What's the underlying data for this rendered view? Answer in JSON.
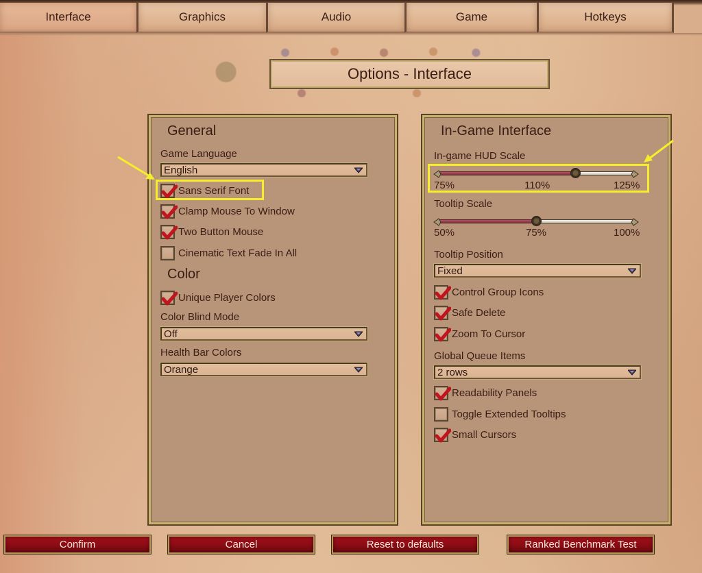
{
  "tabs": [
    {
      "label": "Interface",
      "active": true
    },
    {
      "label": "Graphics",
      "active": false
    },
    {
      "label": "Audio",
      "active": false
    },
    {
      "label": "Game",
      "active": false
    },
    {
      "label": "Hotkeys",
      "active": false
    }
  ],
  "title": "Options - Interface",
  "left_panel": {
    "general": {
      "heading": "General",
      "game_language": {
        "label": "Game Language",
        "value": "English"
      },
      "checkboxes": [
        {
          "label": "Sans Serif Font",
          "checked": true,
          "highlighted": true
        },
        {
          "label": "Clamp Mouse To Window",
          "checked": true
        },
        {
          "label": "Two Button Mouse",
          "checked": true
        },
        {
          "label": "Cinematic Text Fade In All",
          "checked": false
        }
      ]
    },
    "color": {
      "heading": "Color",
      "unique_player_colors": {
        "label": "Unique Player Colors",
        "checked": true
      },
      "color_blind_mode": {
        "label": "Color Blind Mode",
        "value": "Off"
      },
      "health_bar_colors": {
        "label": "Health Bar Colors",
        "value": "Orange"
      }
    }
  },
  "right_panel": {
    "heading": "In-Game Interface",
    "hud_scale": {
      "label": "In-game HUD Scale",
      "min_label": "75%",
      "current_label": "110%",
      "max_label": "125%",
      "min": 75,
      "max": 125,
      "value": 110,
      "highlighted": true
    },
    "tooltip_scale": {
      "label": "Tooltip Scale",
      "min_label": "50%",
      "current_label": "75%",
      "max_label": "100%",
      "min": 50,
      "max": 100,
      "value": 75
    },
    "tooltip_position": {
      "label": "Tooltip Position",
      "value": "Fixed"
    },
    "checkboxes_a": [
      {
        "label": "Control Group Icons",
        "checked": true
      },
      {
        "label": "Safe Delete",
        "checked": true
      },
      {
        "label": "Zoom To Cursor",
        "checked": true
      }
    ],
    "global_queue_items": {
      "label": "Global Queue Items",
      "value": "2 rows"
    },
    "checkboxes_b": [
      {
        "label": "Readability Panels",
        "checked": true
      },
      {
        "label": "Toggle Extended Tooltips",
        "checked": false
      },
      {
        "label": "Small Cursors",
        "checked": true
      }
    ]
  },
  "buttons": {
    "confirm": "Confirm",
    "cancel": "Cancel",
    "reset": "Reset to defaults",
    "benchmark": "Ranked Benchmark Test"
  },
  "colors": {
    "highlight": "#f4ee2c",
    "button_red": "#8a0c14",
    "slider_fill": "#9a3a48",
    "check_red": "#c0141e"
  }
}
